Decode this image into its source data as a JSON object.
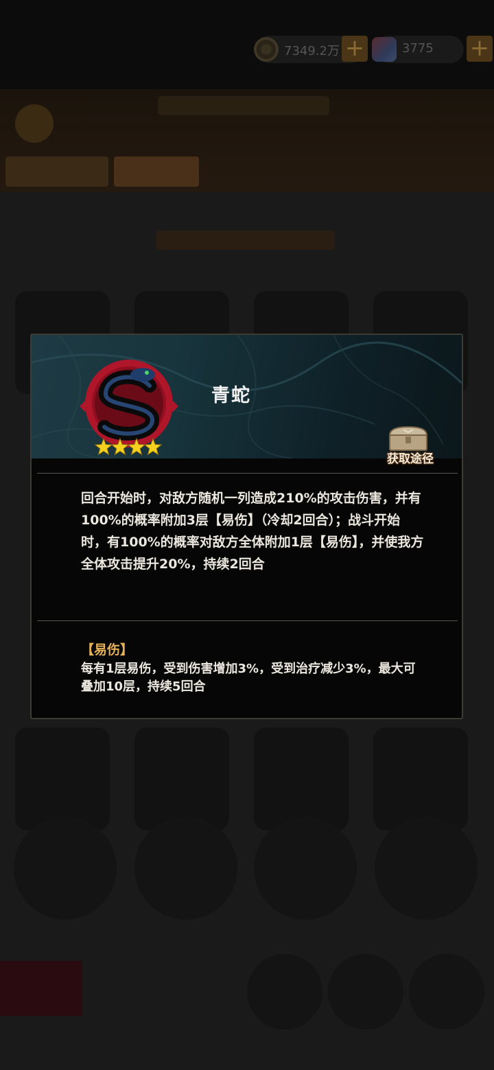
{
  "top_bar": {
    "coin_amount": "7349.2万",
    "gem_amount": "3775"
  },
  "skill_popup": {
    "name": "青蛇",
    "star_count": 4,
    "acquire_label": "获取途径",
    "description": "回合开始时，对敌方随机一列造成210%的攻击伤害，并有100%的概率附加3层【易伤】（冷却2回合）；战斗开始时，有100%的概率对敌方全体附加1层【易伤】，并使我方全体攻击提升20%，持续2回合",
    "debuff_title": "【易伤】",
    "debuff_description": "每有1层易伤，受到伤害增加3%，受到治疗减少3%，最大可叠加10层，持续5回合"
  },
  "colors": {
    "overlay_background": "#131313",
    "modal_background": "#060606",
    "header_teal": "#1e3a44",
    "debuff_title": "#e7b256",
    "star_gold": "#f7d11f",
    "ring_red": "#b0162a"
  },
  "icons": {
    "coin": "coin-icon",
    "gem": "gem-icon",
    "plus": "plus-icon",
    "snake_emblem": "snake-emblem-icon",
    "star": "star-icon",
    "chest": "treasure-chest-icon"
  }
}
